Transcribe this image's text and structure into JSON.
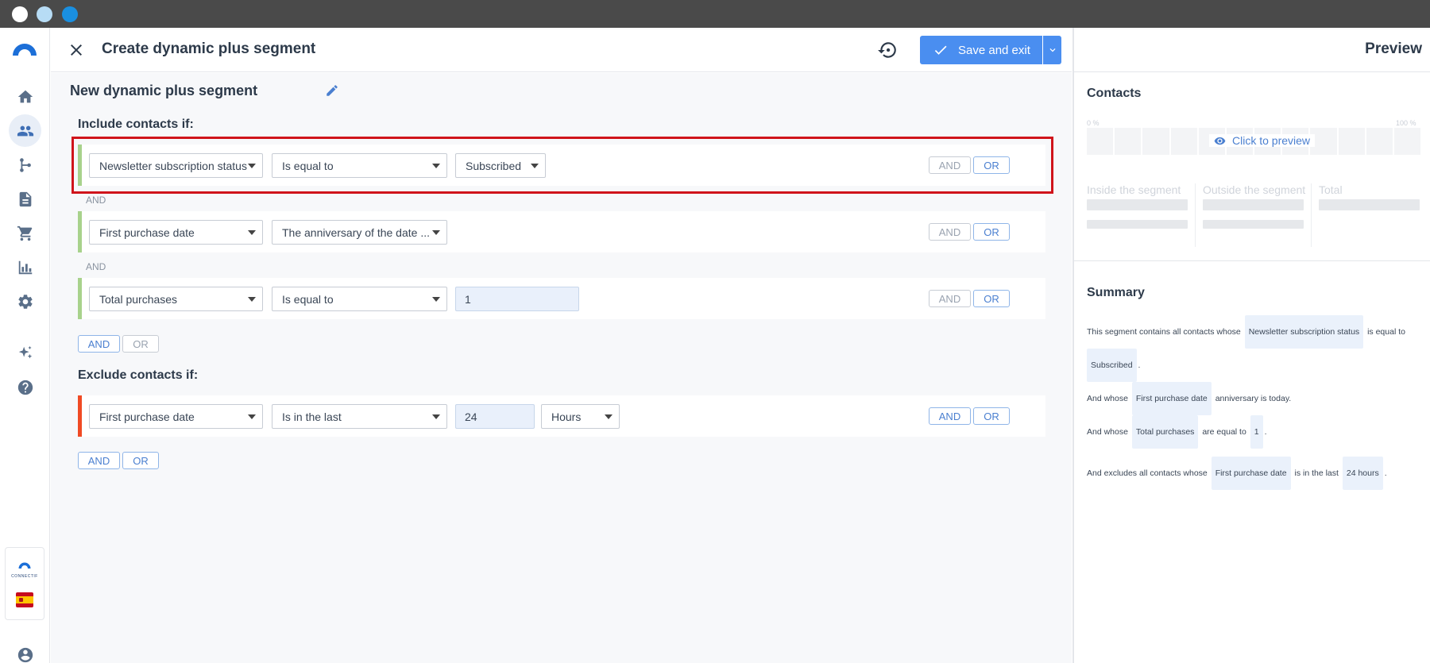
{
  "header": {
    "title": "Create dynamic plus segment",
    "save_label": "Save and exit"
  },
  "segment": {
    "name": "New dynamic plus segment",
    "include_label": "Include contacts if:",
    "exclude_label": "Exclude contacts if:"
  },
  "include_rules": [
    {
      "field": "Newsletter subscription status",
      "operator": "Is equal to",
      "value": "Subscribed",
      "and": "AND",
      "or": "OR"
    },
    {
      "field": "First purchase date",
      "operator": "The anniversary of the date ...",
      "and": "AND",
      "or": "OR"
    },
    {
      "field": "Total purchases",
      "operator": "Is equal to",
      "value": "1",
      "and": "AND",
      "or": "OR"
    }
  ],
  "connectors": [
    "AND",
    "AND"
  ],
  "include_group_buttons": {
    "and": "AND",
    "or": "OR"
  },
  "exclude_rules": [
    {
      "field": "First purchase date",
      "operator": "Is in the last",
      "value": "24",
      "unit": "Hours",
      "and": "AND",
      "or": "OR"
    }
  ],
  "exclude_group_buttons": {
    "and": "AND",
    "or": "OR"
  },
  "preview": {
    "title": "Preview",
    "contacts_title": "Contacts",
    "pct_min": "0 %",
    "pct_max": "100 %",
    "click_to_preview": "Click to preview",
    "inside_label": "Inside the segment",
    "outside_label": "Outside the segment",
    "total_label": "Total",
    "summary_title": "Summary"
  },
  "summary": {
    "s1_pre": "This segment contains all contacts whose",
    "s1_chip1": "Newsletter subscription status",
    "s1_mid": "is equal to",
    "s1_chip2": "Subscribed",
    "s1_end": ".",
    "s2_pre": "And whose",
    "s2_chip": "First purchase date",
    "s2_post": "anniversary is today.",
    "s3_pre": "And whose",
    "s3_chip1": "Total purchases",
    "s3_mid": "are equal to",
    "s3_chip2": "1",
    "s3_end": ".",
    "s4_pre": "And excludes all contacts whose",
    "s4_chip1": "First purchase date",
    "s4_mid": "is in the last",
    "s4_chip2": "24 hours",
    "s4_end": "."
  },
  "brand": {
    "mini_text": "CONNECTIF"
  },
  "colors": {
    "accent": "#4a8ef0",
    "include_bar": "#a8d28c",
    "exclude_bar": "#f04a24",
    "highlight": "#d0141b"
  },
  "icons": [
    "home-icon",
    "contacts-icon",
    "workflow-icon",
    "document-icon",
    "cart-icon",
    "chart-icon",
    "gear-icon",
    "sparkle-icon",
    "help-icon",
    "user-icon",
    "close-icon",
    "history-icon",
    "check-icon",
    "chevron-down-icon",
    "pencil-icon",
    "eye-icon"
  ]
}
